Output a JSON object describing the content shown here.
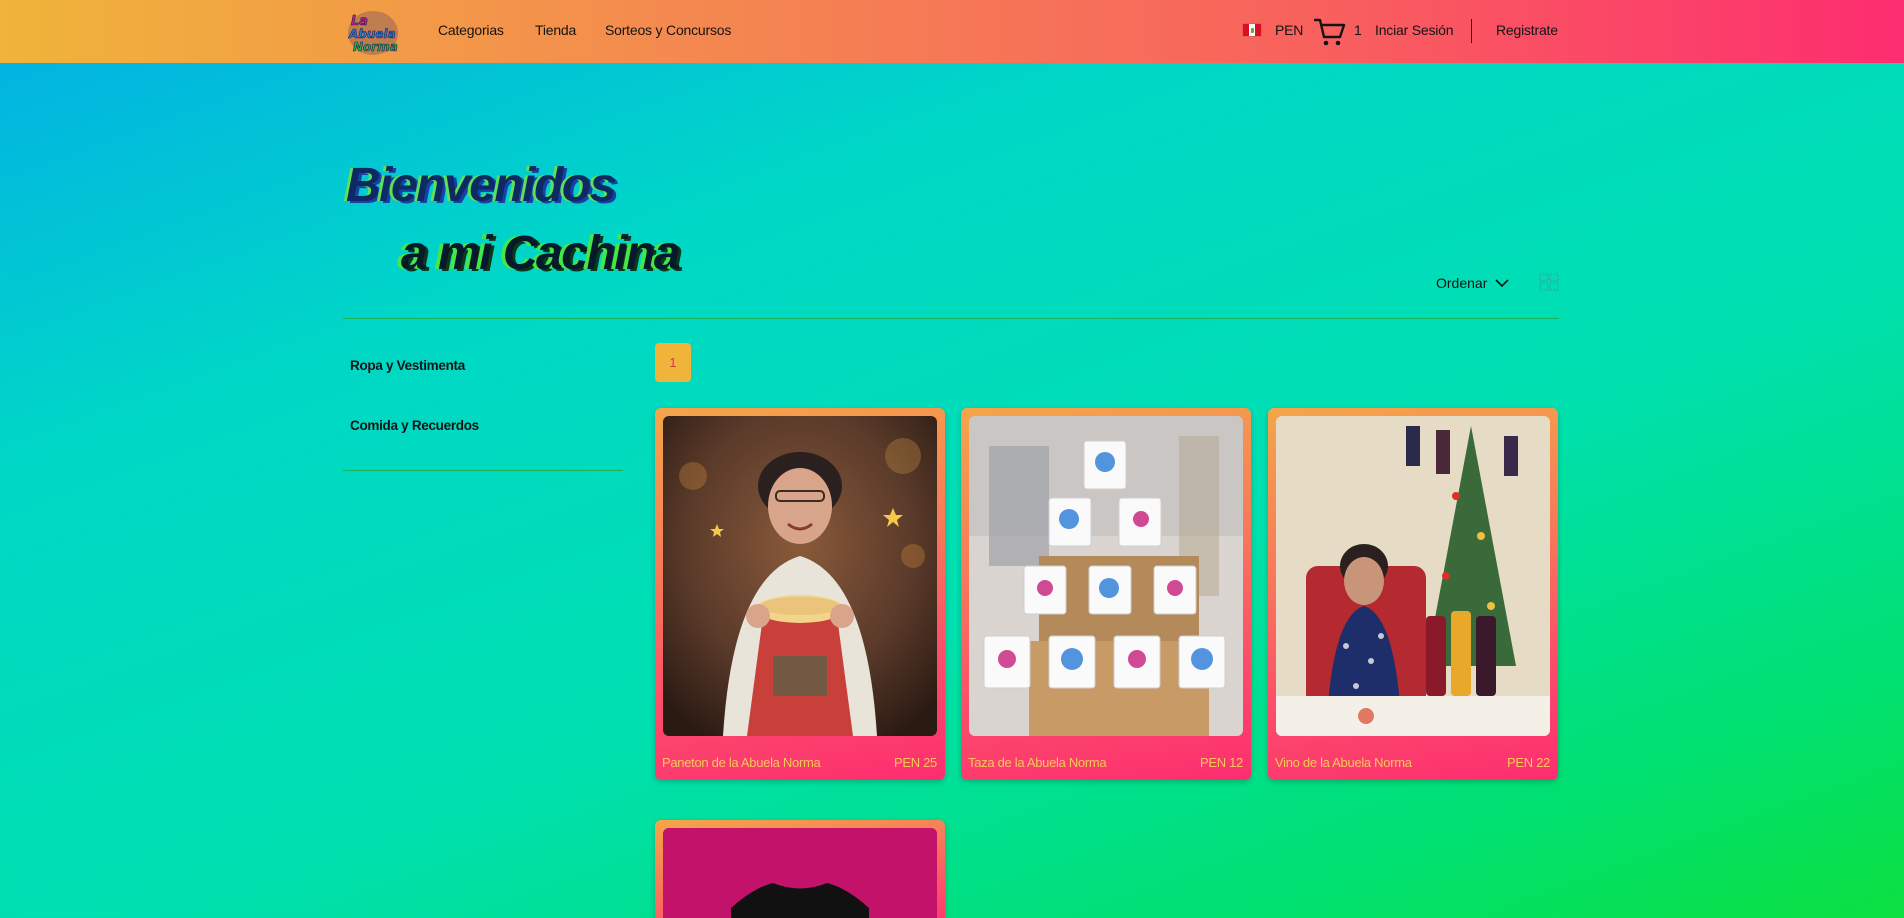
{
  "header": {
    "logo_text": "La Abuela Norma",
    "nav": [
      {
        "label": "Categorias"
      },
      {
        "label": "Tienda"
      },
      {
        "label": "Sorteos y Concursos"
      }
    ],
    "currency": "PEN",
    "cart_count": "1",
    "login_label": "Inciar Sesión",
    "register_label": "Registrate"
  },
  "hero": {
    "line1": "Bienvenidos",
    "line2": "a mi Cachina"
  },
  "toolbar": {
    "sort_label": "Ordenar"
  },
  "sidebar": {
    "categories": [
      {
        "label": "Ropa y Vestimenta"
      },
      {
        "label": "Comida y Recuerdos"
      }
    ]
  },
  "pagination": {
    "current_page": "1"
  },
  "products": [
    {
      "name": "Paneton de la Abuela Norma",
      "price": "PEN 25"
    },
    {
      "name": "Taza de la Abuela Norma",
      "price": "PEN 12"
    },
    {
      "name": "Vino de la Abuela Norma",
      "price": "PEN 22"
    }
  ],
  "colors": {
    "header_gradient_start": "#f0b43a",
    "header_gradient_end": "#fd2d70",
    "page_background_start": "#03aee6",
    "page_background_end": "#0ce040",
    "card_text": "#f6c85a",
    "divider": "#18b25a"
  },
  "icons": [
    "peru-flag-icon",
    "cart-icon",
    "chevron-down-icon",
    "grid-view-icon"
  ]
}
